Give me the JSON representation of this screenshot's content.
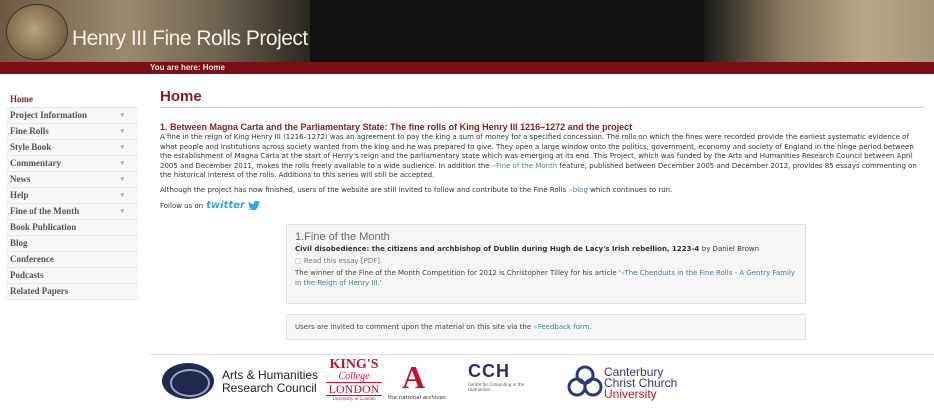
{
  "header": {
    "site_title": "Henry III Fine Rolls Project",
    "breadcrumb": "You are here: Home"
  },
  "sidebar": {
    "items": [
      {
        "label": "Home",
        "active": true,
        "has_submenu": false
      },
      {
        "label": "Project Information",
        "active": false,
        "has_submenu": true
      },
      {
        "label": "Fine Rolls",
        "active": false,
        "has_submenu": true
      },
      {
        "label": "Style Book",
        "active": false,
        "has_submenu": true
      },
      {
        "label": "Commentary",
        "active": false,
        "has_submenu": true
      },
      {
        "label": "News",
        "active": false,
        "has_submenu": true
      },
      {
        "label": "Help",
        "active": false,
        "has_submenu": true
      },
      {
        "label": "Fine of the Month",
        "active": false,
        "has_submenu": true
      },
      {
        "label": "Book Publication",
        "active": false,
        "has_submenu": false
      },
      {
        "label": "Blog",
        "active": false,
        "has_submenu": false
      },
      {
        "label": "Conference",
        "active": false,
        "has_submenu": false
      },
      {
        "label": "Podcasts",
        "active": false,
        "has_submenu": false
      },
      {
        "label": "Related Papers",
        "active": false,
        "has_submenu": false
      }
    ]
  },
  "main": {
    "page_title": "Home",
    "section_heading": "1. Between Magna Carta and the Parliamentary State: The fine rolls of King Henry III 1216–1272 and the project",
    "intro_before_link": "A fine in the reign of King Henry III (1216–1272) was an agreement to pay the king a sum of money for a specified concession. The rolls on which the fines were recorded provide the earliest systematic evidence of what people and institutions across society wanted from the king and he was prepared to give. They open a large window onto the politics, government, economy and society of England in the hinge period between the establishment of Magna Carta at the start of Henry's reign and the parliamentary state which was emerging at its end. This Project, which was funded by the Arts and Humanities Research Council between April 2005 and December 2011, makes the rolls freely available to a wide audience. In addition the",
    "intro_link": "Fine of the Month",
    "intro_after_link": "feature, published between December 2005 and December 2012, provides 85 essays commenting on the historical interest of the rolls. Additions to this series will still be accepted.",
    "para2_before": "Although the project has now finished, users of the website are still invited to follow and contribute to the Fine Rolls",
    "para2_link": "blog",
    "para2_after": "which continues to run.",
    "follow_label": "Follow us on",
    "twitter_label": "twitter"
  },
  "fine_box": {
    "heading": "1.Fine of the Month",
    "essay_title": "Civil disobedience: the citizens and archbishop of Dublin during Hugh de Lacy's Irish rebellion, 1223-4",
    "author": "by Daniel Brown",
    "read_link": "Read this essay [PDF].",
    "winner_before": "The winner of the Fine of the Month Competition for 2012 is Christopher Tilley for his article '",
    "winner_link": "The Chenduits in the Fine Rolls - A Gentry Family in the Reign of Henry III.",
    "winner_after": "'"
  },
  "feedback_box": {
    "before": "Users are invited to comment upon the material on this site via the",
    "link": "Feedback form",
    "after": "."
  },
  "footer": {
    "ahrc_line1": "Arts & Humanities",
    "ahrc_line2": "Research Council",
    "kings_line1": "KING'S",
    "kings_line2": "College",
    "kings_line3": "LONDON",
    "kings_line4": "University of London",
    "tna_letter": "A",
    "tna_text": "the national archives",
    "cch_letters": "CCH",
    "cch_sub": "Centre for Computing in the Humanities",
    "cccu_line1": "Canterbury",
    "cccu_line2": "Christ Church",
    "cccu_line3": "University"
  },
  "colors": {
    "accent_red": "#8b1a1a",
    "header_red_bar": "#7a0f16",
    "link_blue": "#4d7a99",
    "twitter_blue": "#29aae1"
  }
}
